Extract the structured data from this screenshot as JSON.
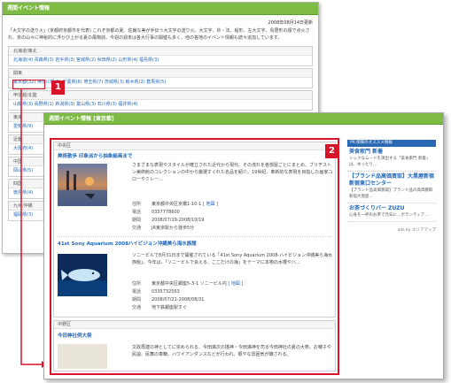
{
  "back": {
    "title": "週間イベント情報",
    "date": "2008年08月14日更新",
    "intro": "「大文字の送り火」(京都府京都市を代表) これぞ京都の夏、荘厳な美が手伝う大文字の送り火。大文字、妙・法、船形、左大文字、鳥居形の順で点火され、京の山々に神秘的に浮かび上がる夏の風物詩。今週の週末は各大行事の開催も多く、他の各地のイベント情報も続々追加しています。",
    "regions": [
      {
        "name": "北海道/東北",
        "links": "北海道(4) 青森県(3) 岩手県(3) 宮城県(2) 秋田県(2) 山形県(4) 福島県(3)"
      },
      {
        "name": "関東",
        "links": "東京都(32) 神奈川県(5) 千葉県(6) 埼玉県(7) 茨城県(3) 栃木県(2) 群馬県(5)"
      },
      {
        "name": "甲信越/北陸",
        "links": "山梨県(3) 長野県(1) 新潟県(3) 富山県(3) 石川県(3) 福井県(4)"
      },
      {
        "name": "東海",
        "links": "愛知県(9)"
      },
      {
        "name": "近畿",
        "links": "大阪府(4)"
      },
      {
        "name": "中国",
        "links": "岡山県(5)"
      },
      {
        "name": "四国",
        "links": "徳島県(4)"
      },
      {
        "name": "九州/沖縄",
        "links": "福岡県(3)"
      }
    ],
    "badge": "1"
  },
  "front": {
    "title": "週間イベント情報 [東京都]",
    "badge": "2",
    "area1": "中央区",
    "area2": "中野区",
    "events": [
      {
        "title": "美術散歩 印象派から抽象絵画まで",
        "desc": "さまざまな表現やスタイルが確立された近代から現代。その流れを各部屋ごとにまとめ、ブリヂストン美術館のコレクションの中から厳選すぐれた名品を紹介。19世紀、革新的な表現を目指した画家コローやミレー…",
        "labels": {
          "address": "住所",
          "tel": "電話",
          "period": "期間",
          "access": "交通"
        },
        "address": "東京都中央区京橋1-10-1",
        "map": "[ 地図 ]",
        "tel": "0357778600",
        "period": "2008/07/19-2008/10/19",
        "access": "JR東京駅から徒歩5分"
      },
      {
        "title": "41st Sony Aquarium 2008ハイビジョン沖縄美ら海水族館",
        "desc": "ソニービルで8月31日まで開催されている「41st Sony Aquarium 2008-ハイビジョン沖縄美ら海水族館」。今年は、「ソニービルで会える、ここだけの海」をテーマに本物の水槽や八…",
        "labels": {
          "address": "住所",
          "tel": "電話",
          "period": "期間",
          "access": "交通"
        },
        "address": "東京都中央区銀座5-3-1 ソニービル内",
        "map": "[ 地図 ]",
        "tel": "0335732563",
        "period": "2008/07/21-2008/08/31",
        "access": "地下鉄銀座駅すぐ"
      },
      {
        "title": "今田神社例大祭",
        "desc": "文政再建の神としてに崇められる、今田満次の描神・今田満神を司る今田神社の夏の大祭。お囃子や民謡、民舞の車輌、ハワイアンダンスなどが行われ、賑やな雰囲気が醸される。"
      }
    ],
    "sidebar": {
      "header": "PR 関東のオススメ情報",
      "blocks": [
        {
          "title": "美食家門 新着",
          "text": "シックなムードを演出する「美食家門 新着」は、ゆったり…"
        },
        {
          "title": "【ブランド品高価買取】大黒屋新宿 新宿東口センター",
          "text": "【ブランド品高価買取】ブランド品の高価買取 新宿大黒屋…"
        },
        {
          "title": "お茶づくりバー ZUZU",
          "text": "心身を一杯のお茶で元気に…ボランティア…"
        }
      ],
      "footer": "ads by エリアマップ"
    }
  }
}
